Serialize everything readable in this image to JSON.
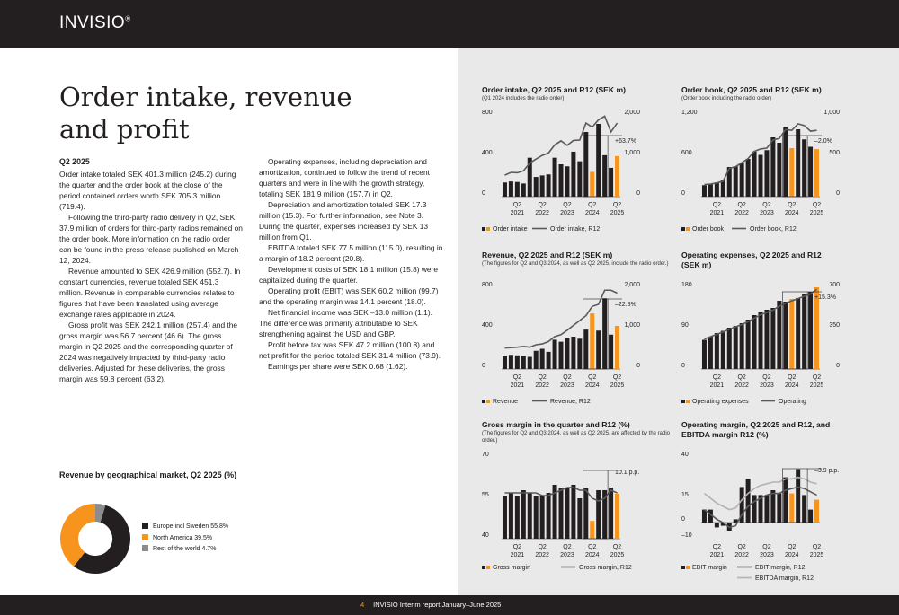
{
  "brand": "INVISIO",
  "brand_mark": "®",
  "footer": {
    "page": "4",
    "text": "INVISIO Interim report January–June 2025"
  },
  "heading": "Order intake, revenue and profit",
  "quarter_heading": "Q2 2025",
  "col1": [
    "Order intake totaled SEK 401.3 million (245.2) during the quarter and the order book at the close of the period contained orders worth SEK 705.3 million (719.4).",
    "Following the third-party radio delivery in Q2, SEK 37.9 million of orders for third-party radios remained on the order book. More information on the radio order can be found in the press release published on March 12, 2024.",
    "Revenue amounted to SEK 426.9 million (552.7). In constant currencies, revenue totaled SEK 451.3 million. Revenue in comparable currencies relates to figures that have been translated using average exchange rates applicable in 2024.",
    "Gross profit was SEK 242.1 million (257.4) and the gross margin was 56.7 percent (46.6). The gross margin in Q2 2025 and the corresponding quarter of 2024 was negatively impacted by third-party radio deliveries. Adjusted for these deliveries, the gross margin was 59.8 percent (63.2)."
  ],
  "col2": [
    "Operating expenses, including depreciation and amortization, continued to follow the trend of recent quarters and were in line with the growth strategy, totaling SEK 181.9 million (157.7) in Q2.",
    "Depreciation and amortization totaled SEK 17.3 million (15.3). For further information, see Note 3. During the quarter, expenses increased by SEK 13 million from Q1.",
    "EBITDA totaled SEK 77.5 million (115.0), resulting in a margin of 18.2 percent (20.8).",
    "Development costs of SEK 18.1 million (15.8) were capitalized during the quarter.",
    "Operating profit (EBIT) was SEK 60.2 million (99.7) and the operating margin was 14.1 percent (18.0).",
    "Net financial income was SEK –13.0 million (1.1). The difference was primarily attributable to SEK strengthening against the USD and GBP.",
    "Profit before tax was SEK 47.2 million (100.8) and net profit for the period totaled SEK 31.4 million (73.9).",
    "Earnings per share were SEK 0.68 (1.62)."
  ],
  "colors": {
    "dark": "#231f20",
    "orange": "#f7941d",
    "grey_line": "#5a5a5a",
    "light_line": "#b3b3b3",
    "panel": "#e9e9e9",
    "slice_grey": "#8c8c8c"
  },
  "chart_data": [
    {
      "id": "geo",
      "type": "pie",
      "donut": true,
      "title": "Revenue by geographical market, Q2 2025 (%)",
      "slices": [
        {
          "name": "Europe incl Sweden 55.8%",
          "value": 55.8
        },
        {
          "name": "North America 39.5%",
          "value": 39.5
        },
        {
          "name": "Rest of the world 4.7%",
          "value": 4.7
        }
      ]
    },
    {
      "id": "oi",
      "type": "bar",
      "title": "Order intake, Q2 2025 and R12 (SEK m)",
      "subtitle": "(Q1 2024 includes the radio order)",
      "left_ticks": [
        "0",
        "400",
        "800"
      ],
      "right_ticks": [
        "0",
        "1,000",
        "2,000"
      ],
      "ylim_left": [
        0,
        800
      ],
      "ylim_right": [
        0,
        2000
      ],
      "categories": [
        "Q2\n2021",
        "Q2\n2022",
        "Q2\n2023",
        "Q2\n2024",
        "Q2\n2025"
      ],
      "bars": [
        140,
        150,
        145,
        130,
        385,
        195,
        210,
        220,
        385,
        320,
        300,
        445,
        350,
        640,
        245,
        720,
        410,
        285,
        401
      ],
      "orange": [
        14,
        18
      ],
      "lines": [
        {
          "name": "Order intake, R12",
          "values": [
            530,
            600,
            590,
            640,
            830,
            930,
            1020,
            1080,
            1280,
            1380,
            1270,
            1390,
            1400,
            1820,
            1720,
            1900,
            1990,
            1600,
            1820
          ]
        }
      ],
      "annotation": "+63.7%",
      "box": [
        13,
        16
      ],
      "legend": [
        "Order intake",
        "Order intake, R12"
      ]
    },
    {
      "id": "ob",
      "type": "bar",
      "title": "Order book, Q2 2025 and R12 (SEK m)",
      "subtitle": "(Order book including the radio order)",
      "left_ticks": [
        "0",
        "600",
        "1,200"
      ],
      "right_ticks": [
        "0",
        "500",
        "1,000"
      ],
      "ylim_left": [
        0,
        1200
      ],
      "ylim_right": [
        0,
        1000
      ],
      "categories": [
        "Q2\n2021",
        "Q2\n2022",
        "Q2\n2023",
        "Q2\n2024",
        "Q2\n2025"
      ],
      "bars": [
        170,
        190,
        210,
        250,
        440,
        450,
        500,
        560,
        670,
        620,
        690,
        880,
        800,
        1030,
        720,
        1000,
        850,
        740,
        705
      ],
      "orange": [
        14,
        18
      ],
      "lines": [
        {
          "name": "Order book, R12",
          "values": [
            150,
            155,
            170,
            190,
            350,
            370,
            420,
            470,
            560,
            590,
            600,
            700,
            720,
            830,
            820,
            900,
            880,
            810,
            820
          ]
        }
      ],
      "annotation": "–2.0%",
      "box": [
        13,
        16
      ],
      "legend": [
        "Order book",
        "Order book, R12"
      ]
    },
    {
      "id": "rev",
      "type": "bar",
      "title": "Revenue, Q2 2025 and R12 (SEK m)",
      "subtitle": "(The figures for Q2 and Q3 2024, as well as Q2 2025, include the radio order.)",
      "left_ticks": [
        "0",
        "400",
        "800"
      ],
      "right_ticks": [
        "0",
        "1,000",
        "2,000"
      ],
      "ylim_left": [
        0,
        800
      ],
      "ylim_right": [
        0,
        2000
      ],
      "categories": [
        "Q2\n2021",
        "Q2\n2022",
        "Q2\n2023",
        "Q2\n2024",
        "Q2\n2025"
      ],
      "bars": [
        130,
        140,
        135,
        130,
        120,
        180,
        200,
        170,
        290,
        270,
        310,
        320,
        300,
        390,
        550,
        380,
        700,
        340,
        427
      ],
      "orange": [
        14,
        18
      ],
      "lines": [
        {
          "name": "Revenue, R12",
          "values": [
            520,
            530,
            540,
            560,
            540,
            600,
            620,
            680,
            800,
            850,
            960,
            1080,
            1200,
            1320,
            1550,
            1600,
            1950,
            1950,
            1880
          ]
        }
      ],
      "annotation": "–22.8%",
      "box": [
        13,
        16
      ],
      "legend": [
        "Revenue",
        "Revenue, R12"
      ]
    },
    {
      "id": "opex",
      "type": "bar",
      "title": "Operating expenses, Q2 2025 and R12 (SEK m)",
      "subtitle": "",
      "left_ticks": [
        "0",
        "90",
        "180"
      ],
      "right_ticks": [
        "0",
        "350",
        "700"
      ],
      "ylim_left": [
        0,
        180
      ],
      "ylim_right": [
        0,
        700
      ],
      "categories": [
        "Q2\n2021",
        "Q2\n2022",
        "Q2\n2023",
        "Q2\n2024",
        "Q2\n2025"
      ],
      "bars": [
        65,
        72,
        80,
        85,
        92,
        96,
        102,
        110,
        120,
        128,
        132,
        136,
        152,
        150,
        156,
        158,
        166,
        172,
        182
      ],
      "orange": [
        14,
        18
      ],
      "lines": [
        {
          "name": "Operating",
          "values": [
            260,
            280,
            300,
            320,
            345,
            365,
            385,
            410,
            440,
            470,
            490,
            510,
            545,
            570,
            590,
            610,
            630,
            650,
            690
          ]
        }
      ],
      "annotation": "+15.3%",
      "box": [
        13,
        16
      ],
      "legend": [
        "Operating expenses",
        "Operating"
      ]
    },
    {
      "id": "gm",
      "type": "bar",
      "title": "Gross margin in the quarter and R12 (%)",
      "subtitle": "(The figures for Q2 and Q3 2024, as well as Q2 2025, are affected by the radio order.)",
      "left_ticks": [
        "40",
        "55",
        "70"
      ],
      "right_ticks": [],
      "ylim_left": [
        40,
        70
      ],
      "categories": [
        "Q2\n2021",
        "Q2\n2022",
        "Q2\n2023",
        "Q2\n2024",
        "Q2\n2025"
      ],
      "bars": [
        56,
        57,
        56,
        58,
        57,
        56,
        56,
        57,
        60,
        59,
        59,
        60,
        55,
        59,
        46.6,
        58,
        58,
        59,
        56.7
      ],
      "orange": [
        14,
        18
      ],
      "lines": [
        {
          "name": "Gross margin, R12",
          "values": [
            57,
            57,
            57,
            57,
            57,
            57,
            56,
            56,
            57,
            58,
            59,
            59,
            58,
            58,
            55,
            54,
            55,
            58,
            57
          ]
        }
      ],
      "annotation": "10.1 p.p.",
      "box": [
        13,
        16
      ],
      "legend": [
        "Gross margin",
        "Gross margin, R12"
      ]
    },
    {
      "id": "om",
      "type": "bar",
      "title": "Operating margin, Q2 2025 and R12, and EBITDA margin R12 (%)",
      "subtitle": "",
      "left_ticks": [
        "–10",
        "0",
        "15",
        "40"
      ],
      "right_ticks": [],
      "ylim_left": [
        -10,
        40
      ],
      "categories": [
        "Q2\n2021",
        "Q2\n2022",
        "Q2\n2023",
        "Q2\n2024",
        "Q2\n2025"
      ],
      "bars": [
        8,
        8,
        -3,
        -2,
        -5,
        2,
        22,
        27,
        17,
        17,
        17,
        20,
        18,
        28,
        18,
        33,
        17,
        8,
        14.1
      ],
      "orange": [
        14,
        18
      ],
      "lines": [
        {
          "name": "EBIT margin, R12",
          "values": [
            8,
            5,
            2,
            0,
            -3,
            -2,
            5,
            10,
            13,
            15,
            17,
            18,
            18,
            20,
            21,
            22,
            21,
            19,
            17
          ]
        },
        {
          "name": "EBITDA margin, R12",
          "values": [
            18,
            15,
            12,
            10,
            8,
            9,
            14,
            18,
            21,
            23,
            24,
            25,
            25,
            27,
            27,
            28,
            27,
            25,
            24
          ]
        }
      ],
      "annotation": "–3.9 p.p.",
      "box": [
        13,
        16
      ],
      "legend": [
        "EBIT margin",
        "EBIT margin, R12",
        "EBITDA margin, R12"
      ]
    }
  ]
}
